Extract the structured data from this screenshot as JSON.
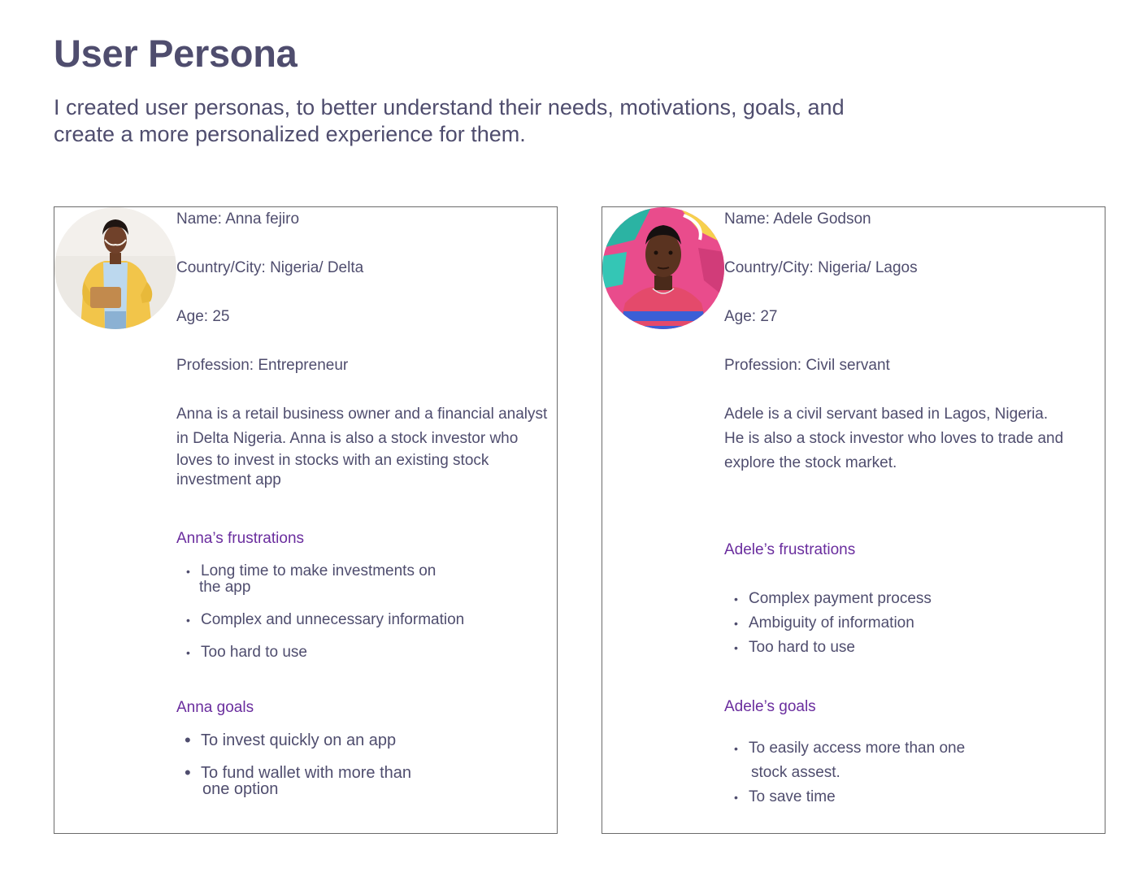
{
  "header": {
    "title": "User Persona",
    "subtitle_line1": "I created user personas, to better understand their needs, motivations, goals, and",
    "subtitle_line2": "create a more personalized experience for them."
  },
  "personas": [
    {
      "name": "Name: Anna fejiro",
      "location": "Country/City: Nigeria/ Delta",
      "age": "Age: 25",
      "profession": "Profession: Entrepreneur",
      "bio": [
        "Anna is a retail business owner and a financial analyst",
        "in Delta Nigeria. Anna is also a stock investor who",
        "loves to invest in stocks with an existing stock",
        "investment app"
      ],
      "frustrations_title": "Anna’s frustrations",
      "frustrations": [
        {
          "line1": "Long time to make investments on",
          "line2": "the app"
        },
        {
          "line1": "Complex and unnecessary information",
          "line2": ""
        },
        {
          "line1": "Too hard to use",
          "line2": ""
        }
      ],
      "goals_title": "Anna goals",
      "goals": [
        {
          "line1": "To invest quickly on an app",
          "line2": ""
        },
        {
          "line1": "To fund wallet with more than",
          "line2": "one option"
        }
      ],
      "photo_icon": "woman-yellow-blazer-photo"
    },
    {
      "name": "Name: Adele Godson",
      "location": "Country/City: Nigeria/ Lagos",
      "age": "Age: 27",
      "profession": "Profession: Civil servant",
      "bio": [
        "Adele is a civil servant based in Lagos, Nigeria.",
        "He is also a stock investor who loves to trade and",
        "explore the stock market."
      ],
      "frustrations_title": "Adele’s frustrations",
      "frustrations": [
        {
          "line1": "Complex payment process",
          "line2": ""
        },
        {
          "line1": "Ambiguity of information",
          "line2": ""
        },
        {
          "line1": "Too hard to use",
          "line2": ""
        }
      ],
      "goals_title": "Adele’s goals",
      "goals": [
        {
          "line1": "To easily access more than one",
          "line2": "stock assest."
        },
        {
          "line1": "To save time",
          "line2": ""
        }
      ],
      "photo_icon": "man-graffiti-wall-photo"
    }
  ],
  "colors": {
    "text": "#4f4d6e",
    "accent": "#6a2d9e",
    "border": "#6b6b6b"
  }
}
